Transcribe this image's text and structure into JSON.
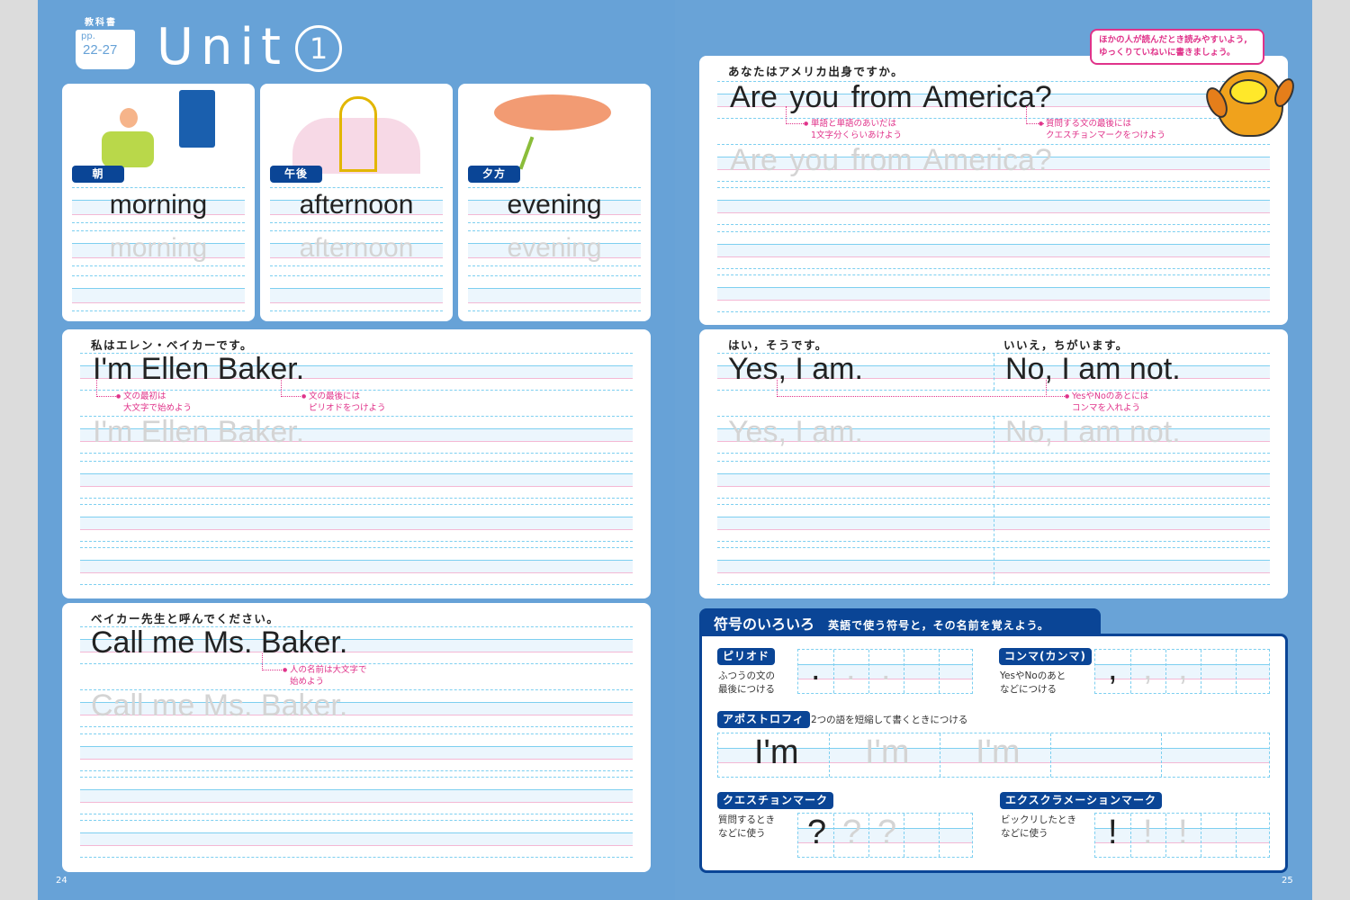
{
  "header": {
    "textbook_label": "教科書",
    "pages_prefix": "pp.",
    "pages": "22-27",
    "unit_title": "Unit",
    "unit_number": "1"
  },
  "time_cards": [
    {
      "label": "朝",
      "word": "morning",
      "illustration": "waking-up-window"
    },
    {
      "label": "午後",
      "word": "afternoon",
      "illustration": "afternoon-tea-stand"
    },
    {
      "label": "夕方",
      "word": "evening",
      "illustration": "sunset-dragonflies"
    }
  ],
  "sentence_ellen": {
    "japanese": "私はエレン・ベイカーです。",
    "english": "I'm Ellen Baker.",
    "notes": [
      {
        "line1": "文の最初は",
        "line2": "大文字で始めよう"
      },
      {
        "line1": "文の最後には",
        "line2": "ピリオドをつけよう"
      }
    ]
  },
  "sentence_call": {
    "japanese": "ベイカー先生と呼んでください。",
    "english": "Call me Ms. Baker.",
    "notes": [
      {
        "line1": "人の名前は大文字で",
        "line2": "始めよう"
      }
    ]
  },
  "sentence_america": {
    "japanese": "あなたはアメリカ出身ですか。",
    "english": "Are you from America?",
    "notes": [
      {
        "line1": "単語と単語のあいだは",
        "line2": "1文字分くらいあけよう"
      },
      {
        "line1": "質問する文の最後には",
        "line2": "クエスチョンマークをつけよう"
      }
    ]
  },
  "speech_bubble": {
    "line1": "ほかの人が読んだとき読みやすいよう,",
    "line2": "ゆっくりていねいに書きましょう。"
  },
  "mascot": "owl",
  "yes_no": {
    "yes_japanese": "はい，そうです。",
    "yes_english": "Yes, I am.",
    "no_japanese": "いいえ，ちがいます。",
    "no_english": "No, I am not.",
    "note": {
      "line1": "YesやNoのあとには",
      "line2": "コンマを入れよう"
    }
  },
  "symbols": {
    "title": "符号のいろいろ",
    "subtitle": "英語で使う符号と，その名前を覚えよう。",
    "period": {
      "name": "ピリオド",
      "desc1": "ふつうの文の",
      "desc2": "最後につける",
      "char": "."
    },
    "comma": {
      "name": "コンマ(カンマ)",
      "desc1": "YesやNoのあと",
      "desc2": "などにつける",
      "char": ","
    },
    "apostrophe": {
      "name": "アポストロフィ",
      "desc": "2つの語を短縮して書くときにつける",
      "example": "I'm"
    },
    "question": {
      "name": "クエスチョンマーク",
      "desc1": "質問するとき",
      "desc2": "などに使う",
      "char": "?"
    },
    "exclamation": {
      "name": "エクスクラメーションマーク",
      "desc1": "ビックリしたとき",
      "desc2": "などに使う",
      "char": "!"
    }
  },
  "page_numbers": {
    "left": "24",
    "right": "25"
  },
  "colors": {
    "page_bg": "#67a2d7",
    "badge": "#0a4596",
    "annotation": "#e0338a",
    "guide_line": "#7dcff0"
  }
}
